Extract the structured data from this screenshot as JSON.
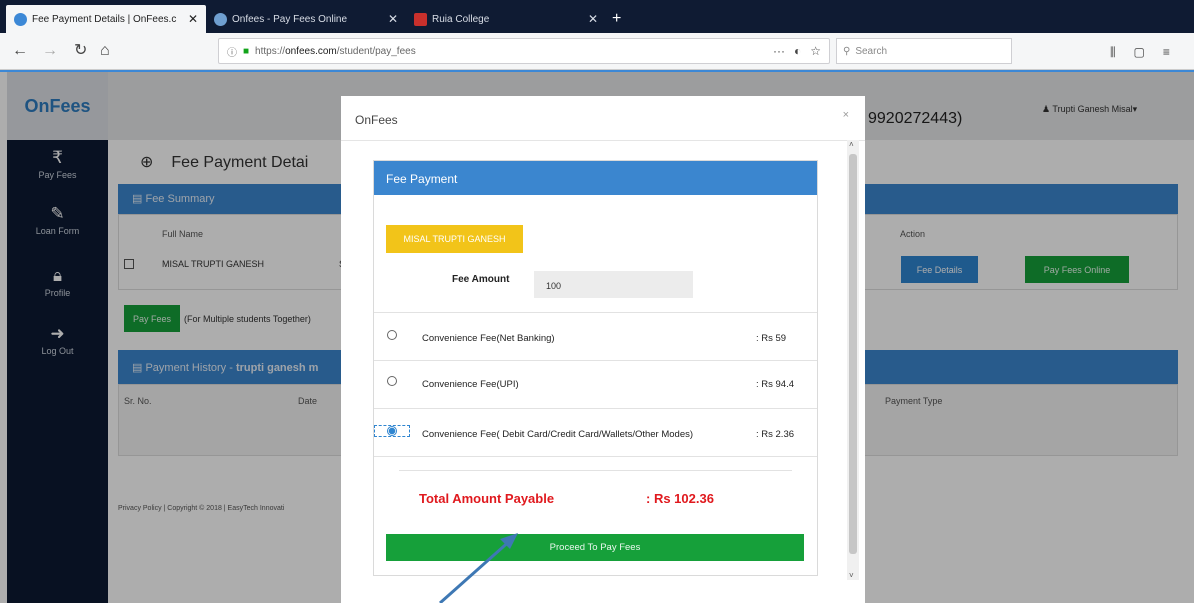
{
  "browser": {
    "tabs": [
      {
        "title": "Fee Payment Details | OnFees.c",
        "active": true
      },
      {
        "title": "Onfees - Pay Fees Online",
        "active": false
      },
      {
        "title": "Ruia College",
        "active": false
      }
    ],
    "url_prefix": "https://",
    "url_domain": "onfees.com",
    "url_path": "/student/pay_fees",
    "search_placeholder": "Search"
  },
  "app": {
    "logo": "OnFees",
    "phone": "9920272443)",
    "user": "Trupti Ganesh Misal",
    "sidebar": [
      {
        "icon": "rupee-icon",
        "label": "Pay Fees"
      },
      {
        "icon": "edit-icon",
        "label": "Loan Form"
      },
      {
        "icon": "lock-icon",
        "label": "Profile"
      },
      {
        "icon": "logout-icon",
        "label": "Log Out"
      }
    ],
    "page_title": "Fee Payment Detai",
    "fee_summary": {
      "heading": "Fee Summary",
      "col_fullname": "Full Name",
      "col_action": "Action",
      "row_name": "MISAL TRUPTI GANESH",
      "row_marker": "S",
      "fee_details_btn": "Fee Details",
      "pay_online_btn": "Pay Fees Online"
    },
    "pay_fees_btn": "Pay Fees",
    "multi_note": "(For Multiple students Together)",
    "payment_history": {
      "heading_prefix": "Payment History - ",
      "heading_name": "trupti ganesh m",
      "col_srno": "Sr. No.",
      "col_date": "Date",
      "col_type": "Payment Type"
    },
    "footer": "Privacy Policy | Copyright © 2018 | EasyTech Innovati"
  },
  "modal": {
    "title": "OnFees",
    "close": "×",
    "panel_heading": "Fee Payment",
    "student_name": "MISAL TRUPTI GANESH",
    "fee_amount_label": "Fee Amount",
    "fee_amount_value": "100",
    "options": [
      {
        "label": "Convenience Fee(Net Banking)",
        "amount": ": Rs 59",
        "selected": false
      },
      {
        "label": "Convenience Fee(UPI)",
        "amount": ": Rs 94.4",
        "selected": false
      },
      {
        "label": "Convenience Fee( Debit Card/Credit Card/Wallets/Other Modes)",
        "amount": ": Rs 2.36",
        "selected": true
      }
    ],
    "total_label": "Total Amount Payable",
    "total_value": ": Rs 102.36",
    "proceed_btn": "Proceed To Pay Fees"
  },
  "colors": {
    "primary_blue": "#3b86cf",
    "success_green": "#16a03a",
    "warning_yellow": "#f2c419",
    "total_red": "#e0191e",
    "sidebar_navy": "#0c1a33"
  }
}
